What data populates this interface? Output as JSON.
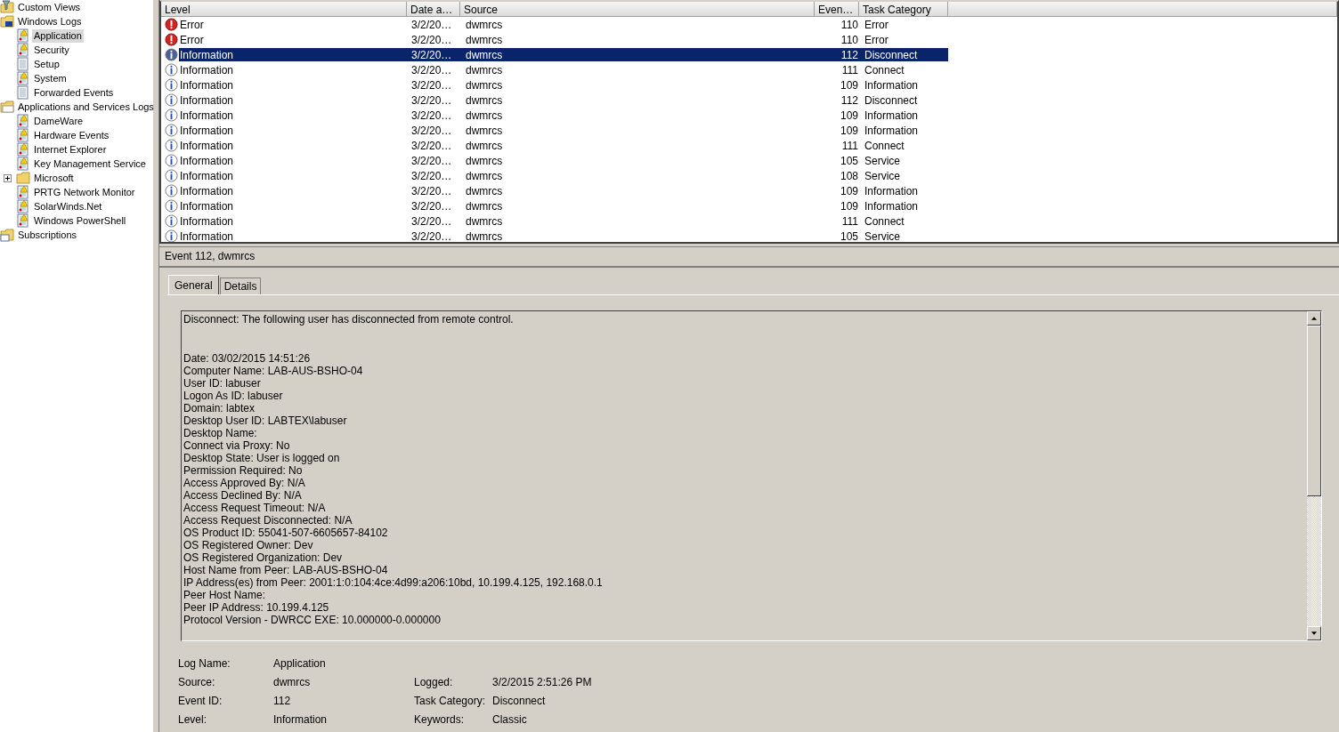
{
  "tree": [
    {
      "label": "Custom Views",
      "kind": "views",
      "selected": false
    },
    {
      "label": "Windows Logs",
      "kind": "computer",
      "selected": false,
      "children": [
        {
          "label": "Application",
          "kind": "log",
          "selected": true
        },
        {
          "label": "Security",
          "kind": "log",
          "selected": false
        },
        {
          "label": "Setup",
          "kind": "log-plain",
          "selected": false
        },
        {
          "label": "System",
          "kind": "log",
          "selected": false
        },
        {
          "label": "Forwarded Events",
          "kind": "log-plain",
          "selected": false
        }
      ]
    },
    {
      "label": "Applications and Services Logs",
      "kind": "folder",
      "selected": false,
      "children": [
        {
          "label": "DameWare",
          "kind": "log",
          "selected": false
        },
        {
          "label": "Hardware Events",
          "kind": "log",
          "selected": false
        },
        {
          "label": "Internet Explorer",
          "kind": "log",
          "selected": false
        },
        {
          "label": "Key Management Service",
          "kind": "log",
          "selected": false
        },
        {
          "label": "Microsoft",
          "kind": "folder",
          "selected": false,
          "expanded": false
        },
        {
          "label": "PRTG Network Monitor",
          "kind": "log",
          "selected": false
        },
        {
          "label": "SolarWinds.Net",
          "kind": "log",
          "selected": false
        },
        {
          "label": "Windows PowerShell",
          "kind": "log",
          "selected": false
        }
      ]
    },
    {
      "label": "Subscriptions",
      "kind": "subscriptions",
      "selected": false
    }
  ],
  "table": {
    "columns": [
      "Level",
      "Date a…",
      "Source",
      "Even…",
      "Task Category"
    ],
    "rows": [
      {
        "kind": "error",
        "level": "Error",
        "date": "3/2/20…",
        "source": "dwmrcs",
        "event_id": "110",
        "task_category": "Error",
        "selected": false
      },
      {
        "kind": "error",
        "level": "Error",
        "date": "3/2/20…",
        "source": "dwmrcs",
        "event_id": "110",
        "task_category": "Error",
        "selected": false
      },
      {
        "kind": "info",
        "level": "Information",
        "date": "3/2/20…",
        "source": "dwmrcs",
        "event_id": "112",
        "task_category": "Disconnect",
        "selected": true
      },
      {
        "kind": "info",
        "level": "Information",
        "date": "3/2/20…",
        "source": "dwmrcs",
        "event_id": "111",
        "task_category": "Connect",
        "selected": false
      },
      {
        "kind": "info",
        "level": "Information",
        "date": "3/2/20…",
        "source": "dwmrcs",
        "event_id": "109",
        "task_category": "Information",
        "selected": false
      },
      {
        "kind": "info",
        "level": "Information",
        "date": "3/2/20…",
        "source": "dwmrcs",
        "event_id": "112",
        "task_category": "Disconnect",
        "selected": false
      },
      {
        "kind": "info",
        "level": "Information",
        "date": "3/2/20…",
        "source": "dwmrcs",
        "event_id": "109",
        "task_category": "Information",
        "selected": false
      },
      {
        "kind": "info",
        "level": "Information",
        "date": "3/2/20…",
        "source": "dwmrcs",
        "event_id": "109",
        "task_category": "Information",
        "selected": false
      },
      {
        "kind": "info",
        "level": "Information",
        "date": "3/2/20…",
        "source": "dwmrcs",
        "event_id": "111",
        "task_category": "Connect",
        "selected": false
      },
      {
        "kind": "info",
        "level": "Information",
        "date": "3/2/20…",
        "source": "dwmrcs",
        "event_id": "105",
        "task_category": "Service",
        "selected": false
      },
      {
        "kind": "info",
        "level": "Information",
        "date": "3/2/20…",
        "source": "dwmrcs",
        "event_id": "108",
        "task_category": "Service",
        "selected": false
      },
      {
        "kind": "info",
        "level": "Information",
        "date": "3/2/20…",
        "source": "dwmrcs",
        "event_id": "109",
        "task_category": "Information",
        "selected": false
      },
      {
        "kind": "info",
        "level": "Information",
        "date": "3/2/20…",
        "source": "dwmrcs",
        "event_id": "109",
        "task_category": "Information",
        "selected": false
      },
      {
        "kind": "info",
        "level": "Information",
        "date": "3/2/20…",
        "source": "dwmrcs",
        "event_id": "111",
        "task_category": "Connect",
        "selected": false
      },
      {
        "kind": "info",
        "level": "Information",
        "date": "3/2/20…",
        "source": "dwmrcs",
        "event_id": "105",
        "task_category": "Service",
        "selected": false
      }
    ]
  },
  "details": {
    "title": "Event 112, dwmrcs",
    "tabs": [
      {
        "label": "General",
        "selected": true
      },
      {
        "label": "Details",
        "selected": false
      }
    ],
    "message": [
      [
        "Disconnect: The following user has disconnected from remote control."
      ],
      [
        "Date: 03/02/2015 14:51:26",
        "Computer Name: LAB-AUS-BSHO-04",
        "User ID: labuser",
        "Logon As ID: labuser",
        "Domain: labtex",
        "Desktop User ID: LABTEX\\labuser",
        "Desktop Name:",
        "Connect via Proxy: No",
        "Desktop State: User is logged on",
        "Permission Required: No",
        "Access Approved By: N/A",
        "Access Declined By: N/A",
        "Access Request Timeout: N/A",
        "Access Request Disconnected: N/A",
        "OS Product ID: 55041-507-6605657-84102",
        "OS Registered Owner: Dev",
        "OS Registered Organization: Dev",
        "Host Name from Peer: LAB-AUS-BSHO-04",
        "IP Address(es) from Peer: 2001:1:0:104:4ce:4d99:a206:10bd, 10.199.4.125, 192.168.0.1",
        "Peer Host Name:",
        "Peer IP Address: 10.199.4.125",
        "Protocol Version - DWRCC EXE: 10.000000-0.000000"
      ]
    ],
    "fields": [
      {
        "label": "Log Name:",
        "value": "Application"
      },
      {
        "label": "Source:",
        "value": "dwmrcs",
        "label_2": "Logged:",
        "value_2": "3/2/2015 2:51:26 PM"
      },
      {
        "label": "Event ID:",
        "value": "112",
        "label_2": "Task Category:",
        "value_2": "Disconnect"
      },
      {
        "label": "Level:",
        "value": "Information",
        "label_2": "Keywords:",
        "value_2": "Classic"
      }
    ]
  }
}
